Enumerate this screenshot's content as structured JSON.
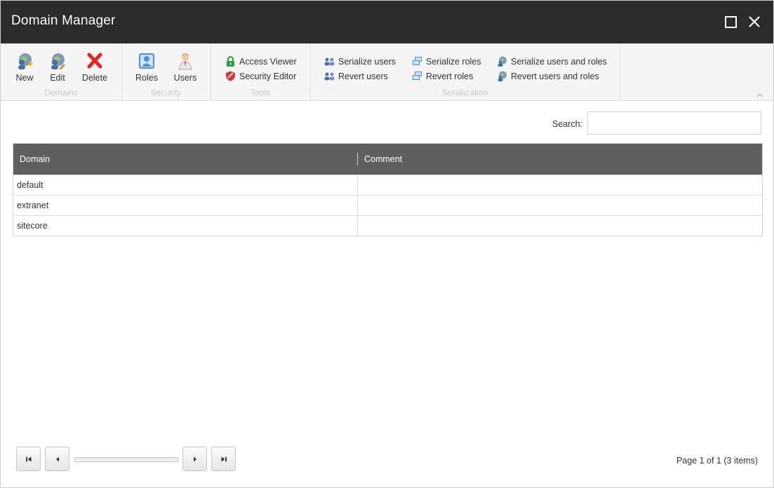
{
  "window": {
    "title": "Domain Manager"
  },
  "ribbon": {
    "groups": {
      "domains": {
        "label": "Domains",
        "buttons": {
          "new": "New",
          "edit": "Edit",
          "delete": "Delete"
        }
      },
      "security": {
        "label": "Security",
        "buttons": {
          "roles": "Roles",
          "users": "Users"
        }
      },
      "tools": {
        "label": "Tools",
        "buttons": {
          "access_viewer": "Access Viewer",
          "security_editor": "Security Editor"
        }
      },
      "serialization": {
        "label": "Serialization",
        "buttons": {
          "serialize_users": "Serialize users",
          "revert_users": "Revert users",
          "serialize_roles": "Serialize roles",
          "revert_roles": "Revert roles",
          "serialize_users_roles": "Serialize users and roles",
          "revert_users_roles": "Revert users and roles"
        }
      }
    }
  },
  "search": {
    "label": "Search:",
    "value": ""
  },
  "grid": {
    "columns": [
      "Domain",
      "Comment"
    ],
    "rows": [
      {
        "domain": "default",
        "comment": ""
      },
      {
        "domain": "extranet",
        "comment": ""
      },
      {
        "domain": "sitecore",
        "comment": ""
      }
    ]
  },
  "pager": {
    "info": "Page 1 of 1 (3 items)"
  },
  "colors": {
    "titlebar": "#2b2b2b",
    "grid_header": "#5f5f5f",
    "delete_red": "#e02424"
  }
}
